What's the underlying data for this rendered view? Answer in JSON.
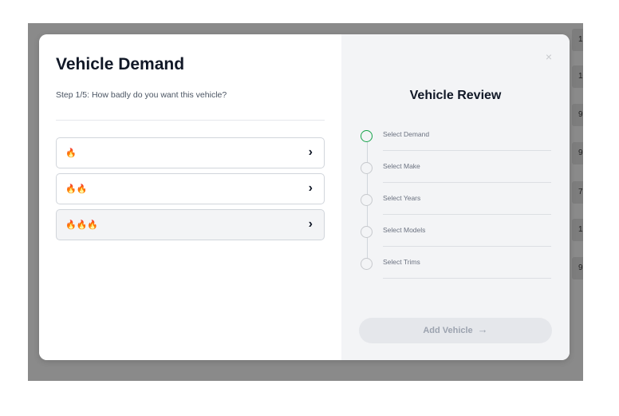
{
  "background": {
    "cells": [
      "1",
      "10",
      "9",
      "9",
      "7",
      "18",
      "9"
    ]
  },
  "demand": {
    "title": "Vehicle Demand",
    "step_text": "Step 1/5: How badly do you want this vehicle?",
    "options": [
      {
        "flames": "🔥",
        "icon": "chevron-right-icon"
      },
      {
        "flames": "🔥🔥",
        "icon": "chevron-right-icon"
      },
      {
        "flames": "🔥🔥🔥",
        "icon": "chevron-right-icon"
      }
    ]
  },
  "review": {
    "title": "Vehicle Review",
    "steps": [
      {
        "label": "Select Demand",
        "state": "current"
      },
      {
        "label": "Select Make",
        "state": "pending"
      },
      {
        "label": "Select Years",
        "state": "pending"
      },
      {
        "label": "Select Models",
        "state": "pending"
      },
      {
        "label": "Select Trims",
        "state": "pending"
      }
    ],
    "add_button_label": "Add Vehicle"
  },
  "icons": {
    "close": "×",
    "chevron": "›",
    "arrow": "→"
  },
  "colors": {
    "current_step": "#16a34a",
    "disabled_button": "#e5e7eb"
  }
}
